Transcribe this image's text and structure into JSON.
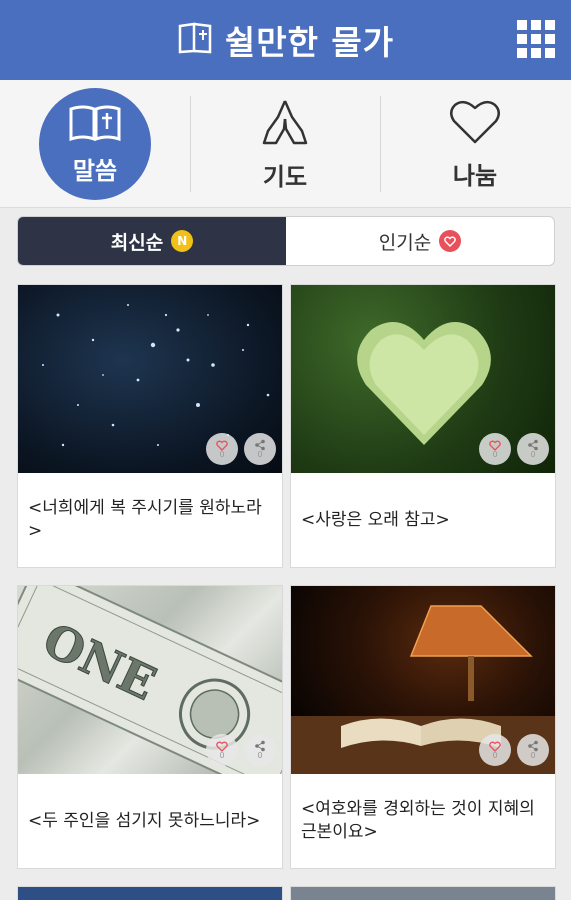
{
  "header": {
    "title": "쉴만한 물가",
    "book_icon": "book-icon",
    "menu_icon": "grid-menu-icon"
  },
  "categories": [
    {
      "label": "말씀",
      "icon": "bible-icon",
      "active": true
    },
    {
      "label": "기도",
      "icon": "praying-hands-icon",
      "active": false
    },
    {
      "label": "나눔",
      "icon": "heart-icon",
      "active": false
    }
  ],
  "sort_tabs": [
    {
      "label": "최신순",
      "badge": "N",
      "active": true
    },
    {
      "label": "인기순",
      "badge": "heart",
      "active": false
    }
  ],
  "cards": [
    {
      "caption": "<너희에게 복 주시기를 원하노라>",
      "like_count": "0",
      "share_count": "0",
      "image": "starry-night"
    },
    {
      "caption": "<사랑은 오래 참고>",
      "like_count": "0",
      "share_count": "0",
      "image": "heart-hedge"
    },
    {
      "caption": "<두 주인을 섬기지 못하느니라>",
      "like_count": "0",
      "share_count": "0",
      "image": "dollar-bill"
    },
    {
      "caption": "<여호와를 경외하는 것이 지혜의 근본이요>",
      "like_count": "0",
      "share_count": "0",
      "image": "lamp-book"
    }
  ],
  "colors": {
    "header": "#4a6fbf",
    "active_tab": "#2e3446",
    "badge_n": "#f2c118",
    "badge_heart": "#e8505b"
  }
}
